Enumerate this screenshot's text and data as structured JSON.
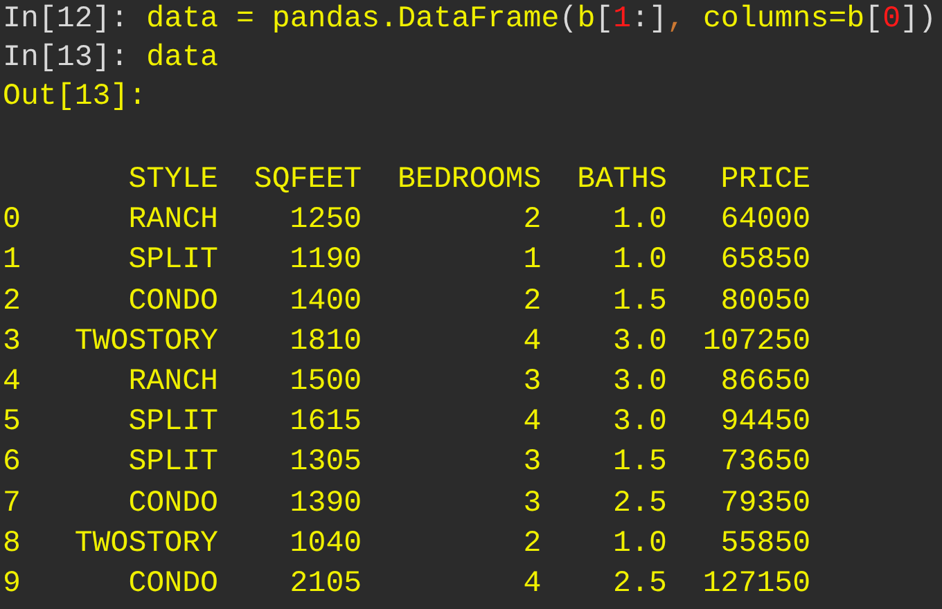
{
  "console": [
    {
      "prompt": "In[12]:",
      "code": [
        {
          "text": " data = pandas.DataFrame",
          "kind": "name"
        },
        {
          "text": "(",
          "kind": "punct"
        },
        {
          "text": "b",
          "kind": "name"
        },
        {
          "text": "[",
          "kind": "punct"
        },
        {
          "text": "1",
          "kind": "number"
        },
        {
          "text": ":]",
          "kind": "punct"
        },
        {
          "text": ",",
          "kind": "sep"
        },
        {
          "text": " columns=b",
          "kind": "name"
        },
        {
          "text": "[",
          "kind": "punct"
        },
        {
          "text": "0",
          "kind": "number"
        },
        {
          "text": "])",
          "kind": "punct"
        }
      ]
    },
    {
      "prompt": "In[13]:",
      "code": [
        {
          "text": " data",
          "kind": "name"
        }
      ]
    }
  ],
  "output_prompt": "Out[13]:",
  "table": {
    "columns": [
      "STYLE",
      "SQFEET",
      "BEDROOMS",
      "BATHS",
      "PRICE"
    ],
    "rows": [
      {
        "index": "0",
        "cells": [
          "RANCH",
          "1250",
          "2",
          "1.0",
          "64000"
        ]
      },
      {
        "index": "1",
        "cells": [
          "SPLIT",
          "1190",
          "1",
          "1.0",
          "65850"
        ]
      },
      {
        "index": "2",
        "cells": [
          "CONDO",
          "1400",
          "2",
          "1.5",
          "80050"
        ]
      },
      {
        "index": "3",
        "cells": [
          "TWOSTORY",
          "1810",
          "4",
          "3.0",
          "107250"
        ]
      },
      {
        "index": "4",
        "cells": [
          "RANCH",
          "1500",
          "3",
          "3.0",
          "86650"
        ]
      },
      {
        "index": "5",
        "cells": [
          "SPLIT",
          "1615",
          "4",
          "3.0",
          "94450"
        ]
      },
      {
        "index": "6",
        "cells": [
          "SPLIT",
          "1305",
          "3",
          "1.5",
          "73650"
        ]
      },
      {
        "index": "7",
        "cells": [
          "CONDO",
          "1390",
          "3",
          "2.5",
          "79350"
        ]
      },
      {
        "index": "8",
        "cells": [
          "TWOSTORY",
          "1040",
          "2",
          "1.0",
          "55850"
        ]
      },
      {
        "index": "9",
        "cells": [
          "CONDO",
          "2105",
          "4",
          "2.5",
          "127150"
        ]
      }
    ]
  }
}
